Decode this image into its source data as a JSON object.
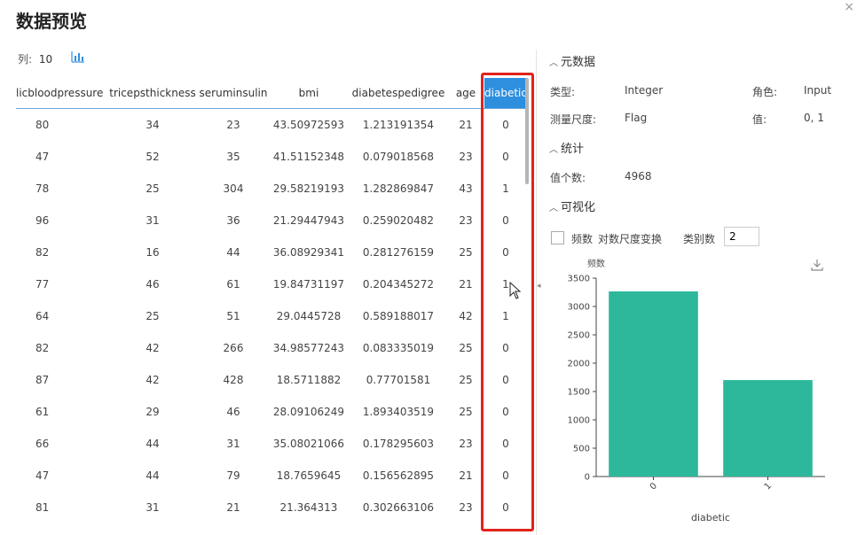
{
  "dialog": {
    "title": "数据预览",
    "close": "×"
  },
  "columns_info": {
    "label": "列:",
    "count": "10"
  },
  "table": {
    "headers": [
      "licbloodpressure",
      "tricepsthickness",
      "seruminsulin",
      "bmi",
      "diabetespedigree",
      "age",
      "diabetic"
    ],
    "rows": [
      [
        "80",
        "34",
        "23",
        "43.50972593",
        "1.213191354",
        "21",
        "0"
      ],
      [
        "47",
        "52",
        "35",
        "41.51152348",
        "0.079018568",
        "23",
        "0"
      ],
      [
        "78",
        "25",
        "304",
        "29.58219193",
        "1.282869847",
        "43",
        "1"
      ],
      [
        "96",
        "31",
        "36",
        "21.29447943",
        "0.259020482",
        "23",
        "0"
      ],
      [
        "82",
        "16",
        "44",
        "36.08929341",
        "0.281276159",
        "25",
        "0"
      ],
      [
        "77",
        "46",
        "61",
        "19.84731197",
        "0.204345272",
        "21",
        "1"
      ],
      [
        "64",
        "25",
        "51",
        "29.0445728",
        "0.589188017",
        "42",
        "1"
      ],
      [
        "82",
        "42",
        "266",
        "34.98577243",
        "0.083335019",
        "25",
        "0"
      ],
      [
        "87",
        "42",
        "428",
        "18.5711882",
        "0.77701581",
        "25",
        "0"
      ],
      [
        "61",
        "29",
        "46",
        "28.09106249",
        "1.893403519",
        "25",
        "0"
      ],
      [
        "66",
        "44",
        "31",
        "35.08021066",
        "0.178295603",
        "23",
        "0"
      ],
      [
        "47",
        "44",
        "79",
        "18.7659645",
        "0.156562895",
        "21",
        "0"
      ],
      [
        "81",
        "31",
        "21",
        "21.364313",
        "0.302663106",
        "23",
        "0"
      ]
    ]
  },
  "metadata": {
    "heading": "元数据",
    "type_label": "类型:",
    "type_value": "Integer",
    "role_label": "角色:",
    "role_value": "Input",
    "measure_label": "测量尺度:",
    "measure_value": "Flag",
    "values_label": "值:",
    "values_value": "0, 1"
  },
  "stats": {
    "heading": "统计",
    "count_label": "值个数:",
    "count_value": "4968"
  },
  "visual": {
    "heading": "可视化",
    "freq_label": "频数",
    "log_label": "对数尺度变换",
    "bins_label": "类别数",
    "bins_value": "2"
  },
  "chart_data": {
    "type": "bar",
    "categories": [
      "0",
      "1"
    ],
    "values": [
      3266,
      1702
    ],
    "xlabel": "diabetic",
    "ylabel": "频数",
    "ylim": [
      0,
      3500
    ],
    "yticks": [
      0,
      500,
      1000,
      1500,
      2000,
      2500,
      3000,
      3500
    ],
    "bar_color": "#2db89c",
    "grid": false
  },
  "colors": {
    "accent": "#2f8fdf",
    "highlight": "#e2231a"
  }
}
